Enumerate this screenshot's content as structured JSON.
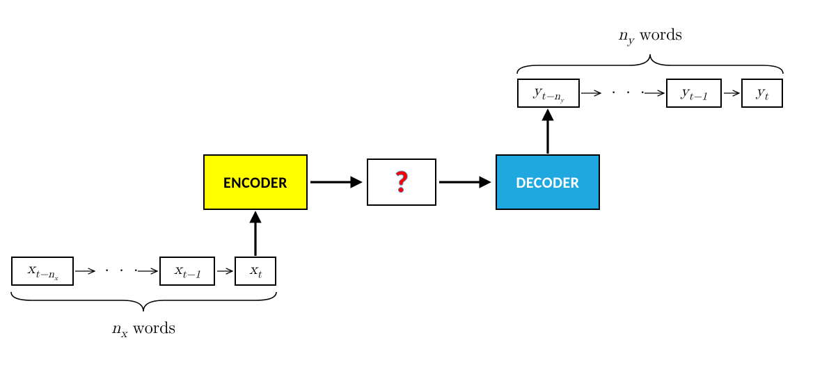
{
  "input": {
    "first": "x<sub class='sub'>t&minus;n<sub class='subsub'>x</sub></sub>",
    "mid": "x<sub class='sub'>t&minus;1</sub>",
    "last": "x<sub class='sub'>t</sub>",
    "brace_label": "<span>n<sub class='sub'>x</sub></span> <span class='normal'>words</span>"
  },
  "output": {
    "first": "y<sub class='sub'>t&minus;n<sub class='subsub'>y</sub></sub>",
    "mid": "y<sub class='sub'>t&minus;1</sub>",
    "last": "y<sub class='sub'>t</sub>",
    "brace_label": "<span>n<sub class='sub'>y</sub></span> <span class='normal'>words</span>"
  },
  "encoder": {
    "label": "ENCODER",
    "fill": "#ffff00"
  },
  "decoder": {
    "label": "DECODER",
    "fill": "#1fa8e0"
  },
  "middle": {
    "label": "?"
  },
  "dots": "· · ·"
}
